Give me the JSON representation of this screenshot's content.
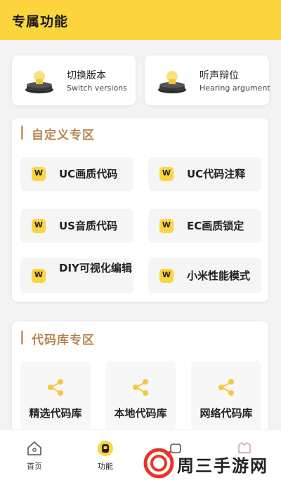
{
  "header": {
    "title": "专属功能"
  },
  "top_cards": [
    {
      "title": "切换版本",
      "subtitle": "Switch versions",
      "icon": "lamp-icon"
    },
    {
      "title": "听声辩位",
      "subtitle": "Hearing argument",
      "icon": "lamp-icon"
    }
  ],
  "custom_section": {
    "title": "自定义专区",
    "items": [
      {
        "label": "UC画质代码",
        "icon_glyph": "W"
      },
      {
        "label": "UC代码注释",
        "icon_glyph": "W"
      },
      {
        "label": "US音质代码",
        "icon_glyph": "W"
      },
      {
        "label": "EC画质锁定",
        "icon_glyph": "W"
      },
      {
        "label": "DIY可视化编辑",
        "icon_glyph": "W"
      },
      {
        "label": "小米性能模式",
        "icon_glyph": "W"
      }
    ]
  },
  "library_section": {
    "title": "代码库专区",
    "items": [
      {
        "label": "精选代码库",
        "icon": "share-icon"
      },
      {
        "label": "本地代码库",
        "icon": "share-icon"
      },
      {
        "label": "网络代码库",
        "icon": "share-icon"
      }
    ]
  },
  "tabbar": {
    "items": [
      {
        "label": "首页",
        "icon": "home-icon"
      },
      {
        "label": "功能",
        "icon": "function-icon",
        "active": true
      },
      {
        "label": "",
        "icon": "tab-icon-3"
      },
      {
        "label": "",
        "icon": "tab-icon-4"
      }
    ]
  },
  "watermark": {
    "text": "周三手游网"
  },
  "colors": {
    "brand_yellow": "#fcd43d",
    "section_title": "#b8834f",
    "share_icon": "#f5c842"
  }
}
